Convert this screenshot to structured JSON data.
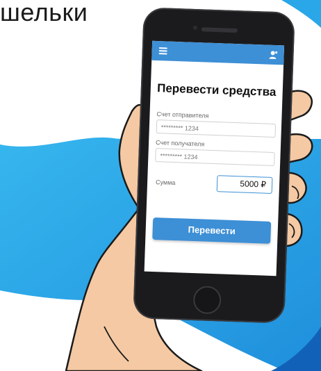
{
  "headline": "шельки",
  "app": {
    "title": "Перевести средства",
    "sender_label": "Счет отправителя",
    "sender_value": "********* 1234",
    "recipient_label": "Счет получателя",
    "recipient_value": "********* 1234",
    "amount_label": "Сумма",
    "amount_value": "5000 ₽",
    "submit_label": "Перевести"
  },
  "icons": {
    "menu": "menu-icon",
    "user": "user-icon"
  },
  "colors": {
    "accent": "#3d8fd6",
    "background_wave": "#2aa7e8",
    "background_wave_dark": "#1473c8"
  }
}
